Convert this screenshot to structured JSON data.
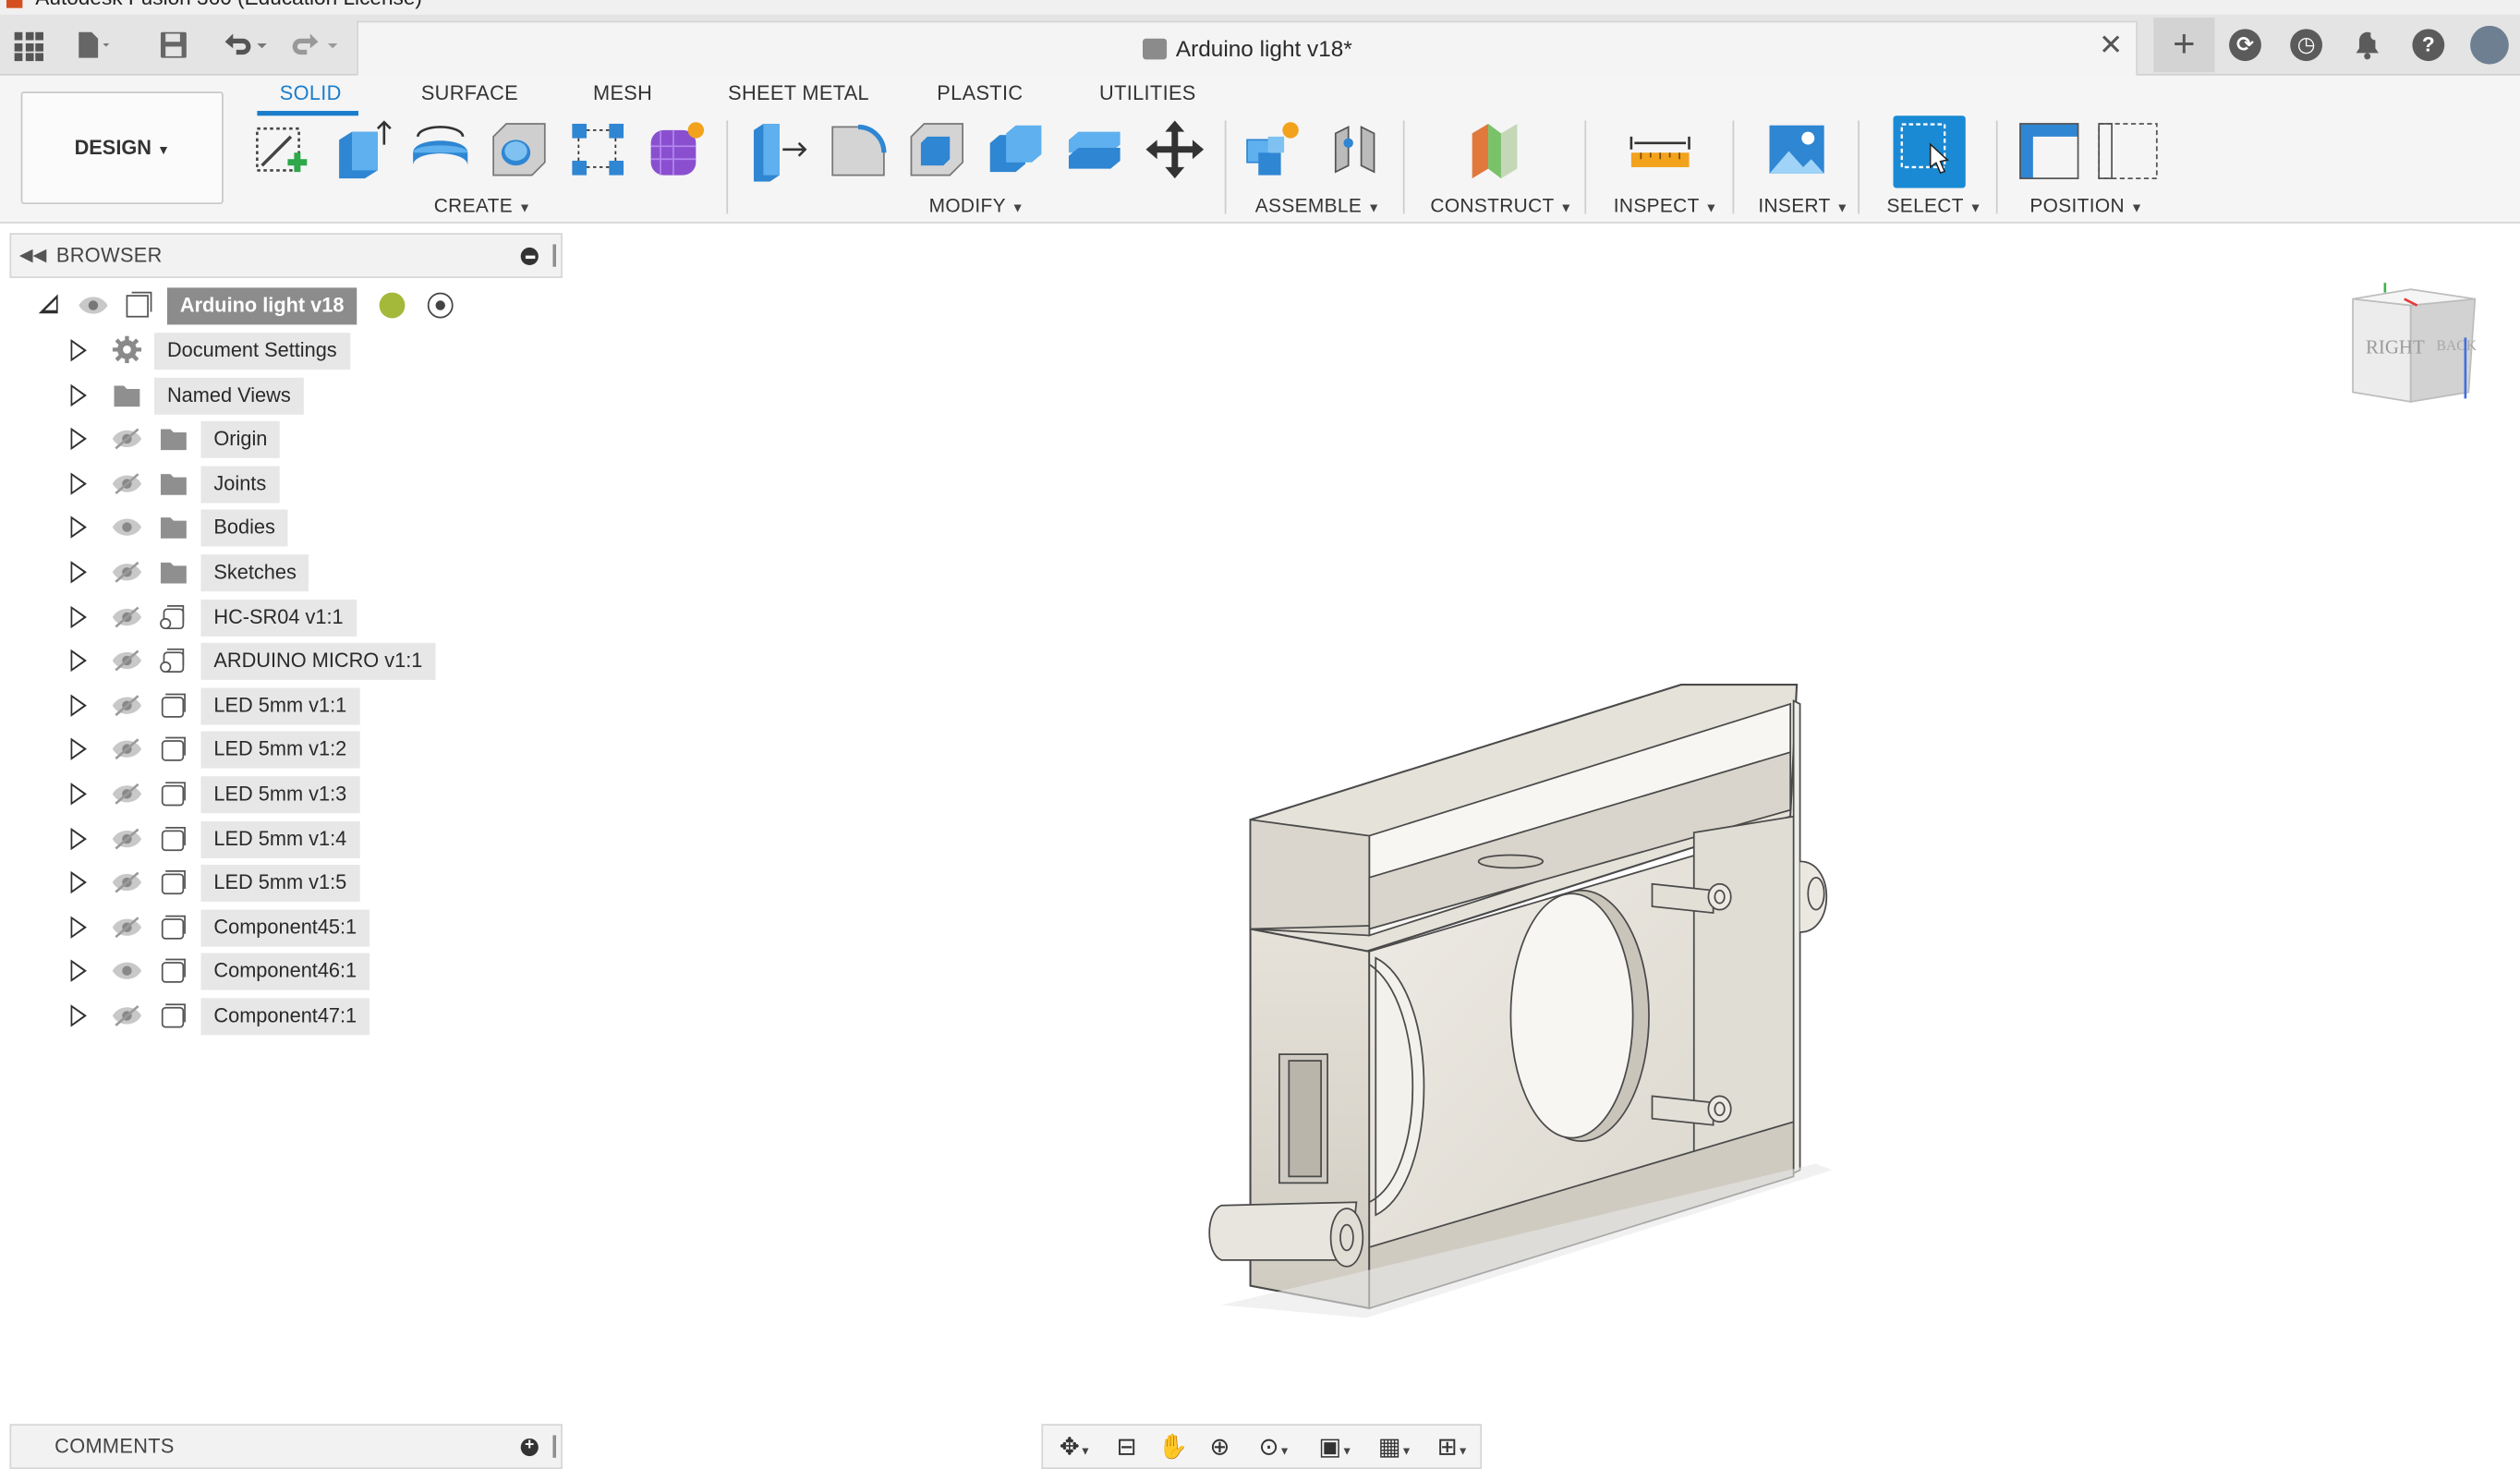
{
  "app": {
    "os_title": "Autodesk Fusion 360 (Education License)",
    "document_title": "Arduino light v18*"
  },
  "workspace_tabs": [
    {
      "label": "SOLID",
      "active": true
    },
    {
      "label": "SURFACE",
      "active": false
    },
    {
      "label": "MESH",
      "active": false
    },
    {
      "label": "SHEET METAL",
      "active": false
    },
    {
      "label": "PLASTIC",
      "active": false
    },
    {
      "label": "UTILITIES",
      "active": false
    }
  ],
  "workspace_switcher": "DESIGN",
  "tool_groups": {
    "create": "CREATE",
    "modify": "MODIFY",
    "assemble": "ASSEMBLE",
    "construct": "CONSTRUCT",
    "inspect": "INSPECT",
    "insert": "INSERT",
    "select": "SELECT",
    "position": "POSITION"
  },
  "browser": {
    "title": "BROWSER",
    "root": "Arduino light v18",
    "items": [
      {
        "label": "Document Settings",
        "icon": "gear-icon",
        "eye": "none"
      },
      {
        "label": "Named Views",
        "icon": "folder-icon",
        "eye": "none"
      },
      {
        "label": "Origin",
        "icon": "folder-icon",
        "eye": "hidden"
      },
      {
        "label": "Joints",
        "icon": "folder-icon",
        "eye": "hidden"
      },
      {
        "label": "Bodies",
        "icon": "folder-icon",
        "eye": "visible"
      },
      {
        "label": "Sketches",
        "icon": "folder-icon",
        "eye": "hidden"
      },
      {
        "label": "HC-SR04 v1:1",
        "icon": "linked-component-icon",
        "eye": "hidden"
      },
      {
        "label": "ARDUINO MICRO v1:1",
        "icon": "linked-component-icon",
        "eye": "hidden"
      },
      {
        "label": "LED 5mm v1:1",
        "icon": "component-icon",
        "eye": "hidden"
      },
      {
        "label": "LED 5mm v1:2",
        "icon": "component-icon",
        "eye": "hidden"
      },
      {
        "label": "LED 5mm v1:3",
        "icon": "component-icon",
        "eye": "hidden"
      },
      {
        "label": "LED 5mm v1:4",
        "icon": "component-icon",
        "eye": "hidden"
      },
      {
        "label": "LED 5mm v1:5",
        "icon": "component-icon",
        "eye": "hidden"
      },
      {
        "label": "Component45:1",
        "icon": "component-icon",
        "eye": "hidden"
      },
      {
        "label": "Component46:1",
        "icon": "component-icon",
        "eye": "visible"
      },
      {
        "label": "Component47:1",
        "icon": "component-icon",
        "eye": "hidden"
      }
    ]
  },
  "comments": {
    "title": "COMMENTS"
  },
  "viewcube": {
    "faces": [
      "RIGHT",
      "BACK"
    ]
  },
  "colors": {
    "accent": "#1a7dcc",
    "model": "#e4e1d9"
  }
}
